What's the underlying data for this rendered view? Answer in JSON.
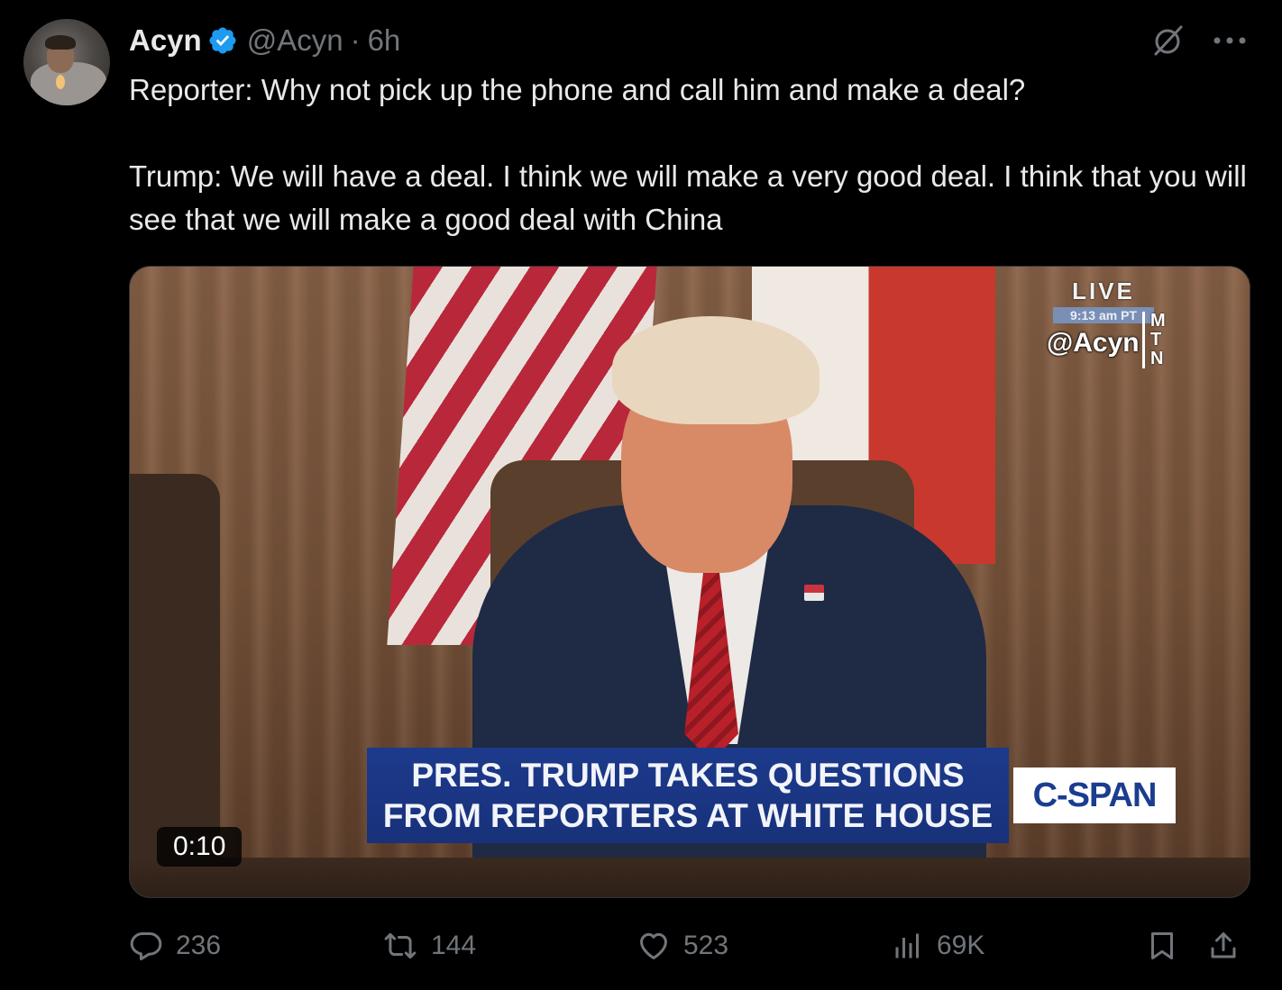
{
  "author": {
    "display_name": "Acyn",
    "handle": "@Acyn",
    "separator": "·",
    "time": "6h",
    "verified": true
  },
  "tweet": {
    "paragraphs": [
      "Reporter: Why not pick up the phone and call him and make a deal?",
      "Trump: We will have a deal. I think we will make a very good deal. I think that you will see that we will make a good deal with China"
    ]
  },
  "media": {
    "live_label": "LIVE",
    "live_time": "9:13 am PT",
    "watermark": "@Acyn",
    "mtn_letters": [
      "M",
      "T",
      "N"
    ],
    "chyron_line1": "PRES. TRUMP TAKES QUESTIONS",
    "chyron_line2": "FROM REPORTERS AT WHITE HOUSE",
    "network_logo": "C-SPAN",
    "duration": "0:10"
  },
  "actions": {
    "replies": "236",
    "reposts": "144",
    "likes": "523",
    "views": "69K"
  },
  "icons": {
    "verified": "verified-badge-icon",
    "grok": "grok-icon",
    "more": "more-icon",
    "reply": "reply-icon",
    "repost": "repost-icon",
    "like": "heart-icon",
    "views": "views-icon",
    "bookmark": "bookmark-icon",
    "share": "share-icon"
  },
  "colors": {
    "background": "#000000",
    "text_primary": "#e7e9ea",
    "text_secondary": "#71767b",
    "verified_blue": "#1d9bf0",
    "chyron_blue": "#1c3a8c"
  }
}
